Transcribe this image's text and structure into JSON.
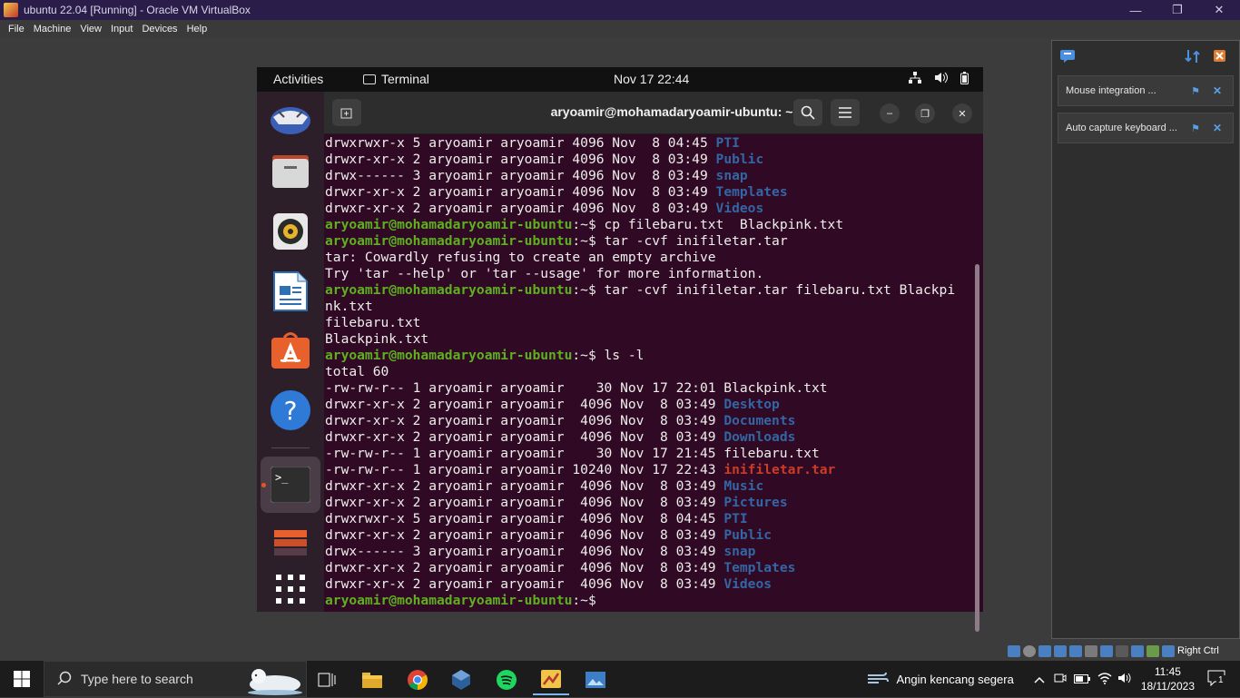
{
  "window": {
    "title": "ubuntu 22.04 [Running] - Oracle VM VirtualBox"
  },
  "menu": [
    "File",
    "Machine",
    "View",
    "Input",
    "Devices",
    "Help"
  ],
  "notifications": [
    {
      "label": "Mouse integration ..."
    },
    {
      "label": "Auto capture keyboard ..."
    }
  ],
  "gnome": {
    "activities": "Activities",
    "app": "Terminal",
    "clock": "Nov 17  22:44"
  },
  "terminal": {
    "title": "aryoamir@mohamadaryoamir-ubuntu: ~",
    "prompt": "aryoamir@mohamadaryoamir-ubuntu",
    "lines": [
      {
        "t": "drwxrwxr-x 5 aryoamir aryoamir 4096 Nov  8 04:45 ",
        "d": "PTI"
      },
      {
        "t": "drwxr-xr-x 2 aryoamir aryoamir 4096 Nov  8 03:49 ",
        "d": "Public"
      },
      {
        "t": "drwx------ 3 aryoamir aryoamir 4096 Nov  8 03:49 ",
        "d": "snap"
      },
      {
        "t": "drwxr-xr-x 2 aryoamir aryoamir 4096 Nov  8 03:49 ",
        "d": "Templates"
      },
      {
        "t": "drwxr-xr-x 2 aryoamir aryoamir 4096 Nov  8 03:49 ",
        "d": "Videos"
      },
      {
        "p": ":~$ cp filebaru.txt  Blackpink.txt"
      },
      {
        "p": ":~$ tar -cvf inifiletar.tar"
      },
      {
        "t": "tar: Cowardly refusing to create an empty archive"
      },
      {
        "t": "Try 'tar --help' or 'tar --usage' for more information."
      },
      {
        "p": ":~$ tar -cvf inifiletar.tar filebaru.txt Blackpi"
      },
      {
        "t": "nk.txt"
      },
      {
        "t": "filebaru.txt"
      },
      {
        "t": "Blackpink.txt"
      },
      {
        "p": ":~$ ls -l"
      },
      {
        "t": "total 60"
      },
      {
        "t": "-rw-rw-r-- 1 aryoamir aryoamir    30 Nov 17 22:01 Blackpink.txt"
      },
      {
        "t": "drwxr-xr-x 2 aryoamir aryoamir  4096 Nov  8 03:49 ",
        "d": "Desktop"
      },
      {
        "t": "drwxr-xr-x 2 aryoamir aryoamir  4096 Nov  8 03:49 ",
        "d": "Documents"
      },
      {
        "t": "drwxr-xr-x 2 aryoamir aryoamir  4096 Nov  8 03:49 ",
        "d": "Downloads"
      },
      {
        "t": "-rw-rw-r-- 1 aryoamir aryoamir    30 Nov 17 21:45 filebaru.txt"
      },
      {
        "t": "-rw-rw-r-- 1 aryoamir aryoamir 10240 Nov 17 22:43 ",
        "a": "inifiletar.tar"
      },
      {
        "t": "drwxr-xr-x 2 aryoamir aryoamir  4096 Nov  8 03:49 ",
        "d": "Music"
      },
      {
        "t": "drwxr-xr-x 2 aryoamir aryoamir  4096 Nov  8 03:49 ",
        "d": "Pictures"
      },
      {
        "t": "drwxrwxr-x 5 aryoamir aryoamir  4096 Nov  8 04:45 ",
        "d": "PTI"
      },
      {
        "t": "drwxr-xr-x 2 aryoamir aryoamir  4096 Nov  8 03:49 ",
        "d": "Public"
      },
      {
        "t": "drwx------ 3 aryoamir aryoamir  4096 Nov  8 03:49 ",
        "d": "snap"
      },
      {
        "t": "drwxr-xr-x 2 aryoamir aryoamir  4096 Nov  8 03:49 ",
        "d": "Templates"
      },
      {
        "t": "drwxr-xr-x 2 aryoamir aryoamir  4096 Nov  8 03:49 ",
        "d": "Videos"
      },
      {
        "p": ":~$ "
      }
    ]
  },
  "vbox_status": {
    "host_key": "Right Ctrl"
  },
  "taskbar": {
    "search_placeholder": "Type here to search",
    "weather": "Angin kencang segera",
    "time": "11:45",
    "date": "18/11/2023",
    "notif_count": "1"
  },
  "colors": {
    "terminal_bg": "#300a24",
    "prompt": "#5fb01f",
    "dir": "#3465a4",
    "archive": "#cc3b26"
  }
}
